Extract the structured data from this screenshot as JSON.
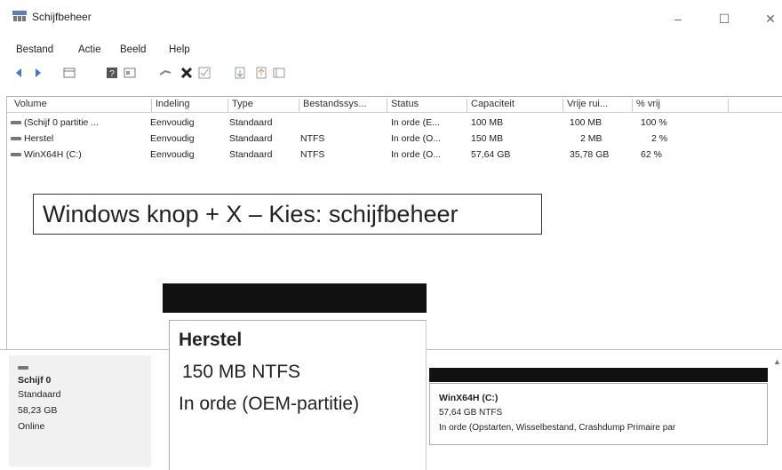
{
  "window": {
    "title": "Schijfbeheer",
    "minimize": "–",
    "maximize": "☐",
    "close": "✕"
  },
  "menu": [
    "Bestand",
    "Actie",
    "Beeld",
    "Help"
  ],
  "toolbar": {
    "icons": [
      "back-icon",
      "forward-icon",
      "list-view-icon",
      "help-icon",
      "properties-icon",
      "connect-icon",
      "delete-icon",
      "check-icon",
      "import-icon",
      "export-icon",
      "settings-icon"
    ]
  },
  "columns": [
    "Volume",
    "Indeling",
    "Type",
    "Bestandssys...",
    "Status",
    "Capaciteit",
    "Vrije rui...",
    "% vrij"
  ],
  "rows": [
    {
      "volume": "(Schijf 0 partitie ...",
      "indeling": "Eenvoudig",
      "type": "Standaard",
      "fs": "",
      "status": "In orde (E...",
      "capacity": "100 MB",
      "free": "100 MB",
      "pct": "100 %"
    },
    {
      "volume": "Herstel",
      "indeling": "Eenvoudig",
      "type": "Standaard",
      "fs": "NTFS",
      "status": "In orde (O...",
      "capacity": "150 MB",
      "free": "2 MB",
      "pct": "2 %"
    },
    {
      "volume": "WinX64H (C:)",
      "indeling": "Eenvoudig",
      "type": "Standaard",
      "fs": "NTFS",
      "status": "In orde (O...",
      "capacity": "57,64 GB",
      "free": "35,78 GB",
      "pct": "62 %"
    }
  ],
  "caption": "Windows knop + X – Kies: schijfbeheer",
  "disk": {
    "name": "Schijf 0",
    "type": "Standaard",
    "size": "58,23 GB",
    "state": "Online"
  },
  "herstel": {
    "title": "Herstel",
    "line1": "150 MB NTFS",
    "line2": "In orde (OEM-partitie)"
  },
  "c_partition": {
    "title": "WinX64H  (C:)",
    "line1": "57,64 GB NTFS",
    "line2": "In orde (Opstarten, Wisselbestand, Crashdump Primaire par"
  }
}
